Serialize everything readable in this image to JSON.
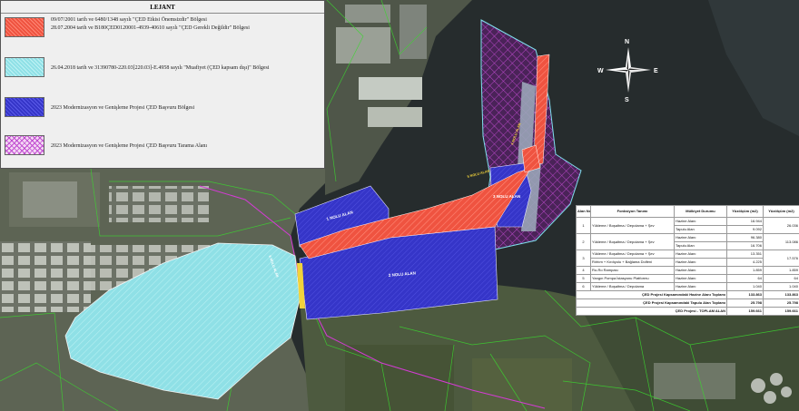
{
  "legend": {
    "title": "LEJANT",
    "entries": [
      {
        "lines": [
          "09/07/2001 tarih ve 6480/1348 sayılı \"ÇED Etkisi Önemsizdir\" Bölgesi",
          "28.07.2004 tarih ve B180ÇED0120001-4939-40610 sayılı \"ÇED Gerekli Değildir\" Bölgesi"
        ],
        "color": "#ef5340"
      },
      {
        "lines": [
          "26.04.2018 tarih ve 31390780-220.03[220.03]-E.4958 sayılı \"Muafiyet (ÇED kapsam dışı)\" Bölgesi"
        ],
        "color": "#8fe0e6"
      },
      {
        "lines": [
          "2023 Modernizasyon ve Genişleme Projesi ÇED Başvuru Bölgesi"
        ],
        "color": "#3535c8"
      },
      {
        "lines": [
          "2023 Modernizasyon ve Genişleme Projesi ÇED Başvuru Tarama Alanı"
        ],
        "color": "#b545c0"
      }
    ]
  },
  "compass": {
    "north": "N",
    "south": "S",
    "east": "E",
    "west": "W"
  },
  "map_labels": {
    "area1": "1 NOLU ALAN",
    "area2": "2 NOLU ALAN",
    "area3": "3 NOLU ALAN",
    "area4": "4 NOLU ALAN",
    "area5": "5 NOLU ALAN",
    "area6": "6 NOLU ALAN"
  },
  "table": {
    "headers": [
      "Alan No",
      "Fonksiyon Tanımı",
      "Mülkiyet Durumu",
      "Yüzölçüm (m2)",
      "Yüzölçüm (m2)"
    ],
    "rows": [
      {
        "no": "1",
        "func": "Yükleme / Boşaltma / Depolama + Şev",
        "owner": "Hazine Alanı",
        "area": "16.944",
        "total": "26.036"
      },
      {
        "no": "",
        "func": "",
        "owner": "Tapulu Alan",
        "area": "9.092",
        "total": ""
      },
      {
        "no": "2",
        "func": "Yükleme / Boşaltma / Depolama + Şev",
        "owner": "Hazine Alanı",
        "area": "96.380",
        "total": "113.086"
      },
      {
        "no": "",
        "func": "",
        "owner": "Tapulu Alan",
        "area": "16.706",
        "total": ""
      },
      {
        "no": "3",
        "func": "Yükleme / Boşaltma / Depolama + Şev",
        "owner": "Hazine Alanı",
        "area": "13.351",
        "total": "17.576"
      },
      {
        "no": "",
        "func": "Rıhtım + Kırdıyolu + Bağlama Dolfeni",
        "owner": "Hazine Alanı",
        "area": "4.225",
        "total": ""
      },
      {
        "no": "4",
        "func": "Ro-Ro Rampası",
        "owner": "Hazine Alanı",
        "area": "1.859",
        "total": "1.859"
      },
      {
        "no": "5",
        "func": "Yangın Pompa İstasyonu Platformu",
        "owner": "Hazine Alanı",
        "area": "64",
        "total": "64"
      },
      {
        "no": "6",
        "func": "Yükleme / Boşaltma / Depolama",
        "owner": "Hazine Alanı",
        "area": "1.040",
        "total": "1.040"
      }
    ],
    "summary": [
      {
        "label": "ÇED Projesi Kapsamındaki Hazine Alanı Toplamı",
        "area": "133.863",
        "total": "133.863"
      },
      {
        "label": "ÇED Projesi Kapsamındaki Tapulu Alan Toplamı",
        "area": "25.798",
        "total": "25.798"
      },
      {
        "label": "ÇED Projesi - TOPLAM ALAN",
        "area": "159.661",
        "total": "159.661"
      }
    ]
  }
}
